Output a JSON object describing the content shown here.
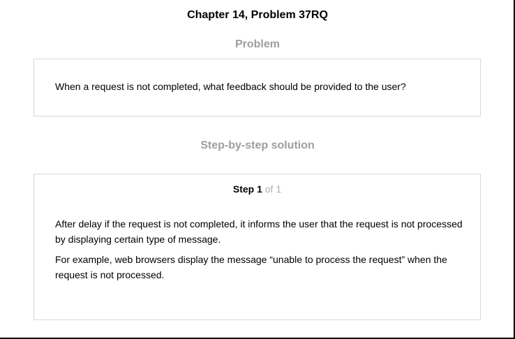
{
  "chapter_title": "Chapter 14, Problem 37RQ",
  "problem": {
    "heading": "Problem",
    "text": "When a request is not completed, what feedback should be provided to the user?"
  },
  "solution": {
    "heading": "Step-by-step solution",
    "step_label": "Step 1",
    "step_of": "of 1",
    "paragraphs": [
      "After delay if the request is not completed, it informs the user that the request is not processed by displaying certain type of message.",
      "For example, web browsers display the message “unable to process the request” when the request is not processed."
    ]
  }
}
